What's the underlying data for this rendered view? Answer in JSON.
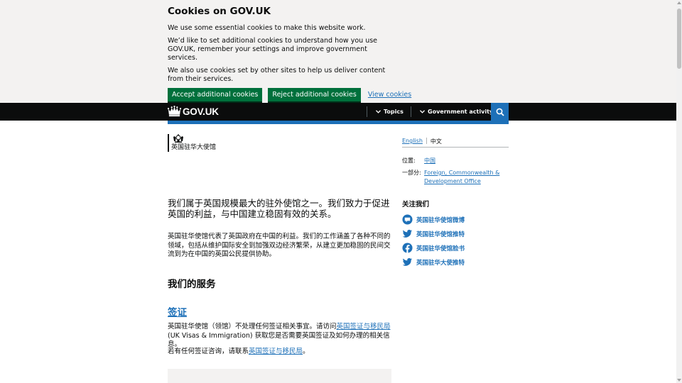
{
  "cookie_banner": {
    "title": "Cookies on GOV.UK",
    "p1": "We use some essential cookies to make this website work.",
    "p2": "We’d like to set additional cookies to understand how you use GOV.UK, remember your settings and improve government services.",
    "p3": "We also use cookies set by other sites to help us deliver content from their services.",
    "accept_label": "Accept additional cookies",
    "reject_label": "Reject additional cookies",
    "view_label": "View cookies"
  },
  "header": {
    "logo_text": "GOV.UK",
    "nav_topics": "Topics",
    "nav_government_activity": "Government activity",
    "search_icon": "search-icon"
  },
  "org": {
    "name": "英国驻华大使馆"
  },
  "main": {
    "lead": "我们属于英国规模最大的驻外使馆之一。我们致力于促进英国的利益，与中国建立稳固有效的关系。",
    "intro": "英国驻华使馆代表了英国政府在中国的利益。我们的工作涵盖了各种不同的领域，包括从维护国际安全到加强双边经济繁荣，从建立更加稳固的民间交流到为在中国的英国公民提供协助。",
    "services_heading": "我们的服务",
    "visa_heading": "签证",
    "visa_p1_before": "英国驻华使馆（领馆）不处理任何签证相关事宜。请访问",
    "visa_p1_link": "英国签证与移民局",
    "visa_p1_after": "(UK Visas & Immigration) 获取您是否需要英国签证及如何办理的相关信息。",
    "visa_p2_before": "若有任何签证咨询，请联系",
    "visa_p2_link": "英国签证与移民局",
    "visa_p2_after": "。"
  },
  "sidebar": {
    "lang_english": "English",
    "lang_chinese": "中文",
    "location_label": "位置:",
    "location_value": "中国",
    "part_of_label": "一部分:",
    "part_of_value": "Foreign, Commonwealth & Development Office",
    "follow_title": "关注我们",
    "social": [
      {
        "label": "英国驻华使馆微博",
        "icon": "weibo-icon"
      },
      {
        "label": "英国驻华使馆推特",
        "icon": "twitter-icon"
      },
      {
        "label": "英国驻华使馆脸书",
        "icon": "facebook-icon"
      },
      {
        "label": "英国驻华大使推特",
        "icon": "twitter-icon"
      }
    ]
  },
  "colors": {
    "link": "#1d70b8",
    "header_bg": "#0b0c0c",
    "button_green": "#00703c",
    "banner_bg": "#f3f2f1"
  }
}
